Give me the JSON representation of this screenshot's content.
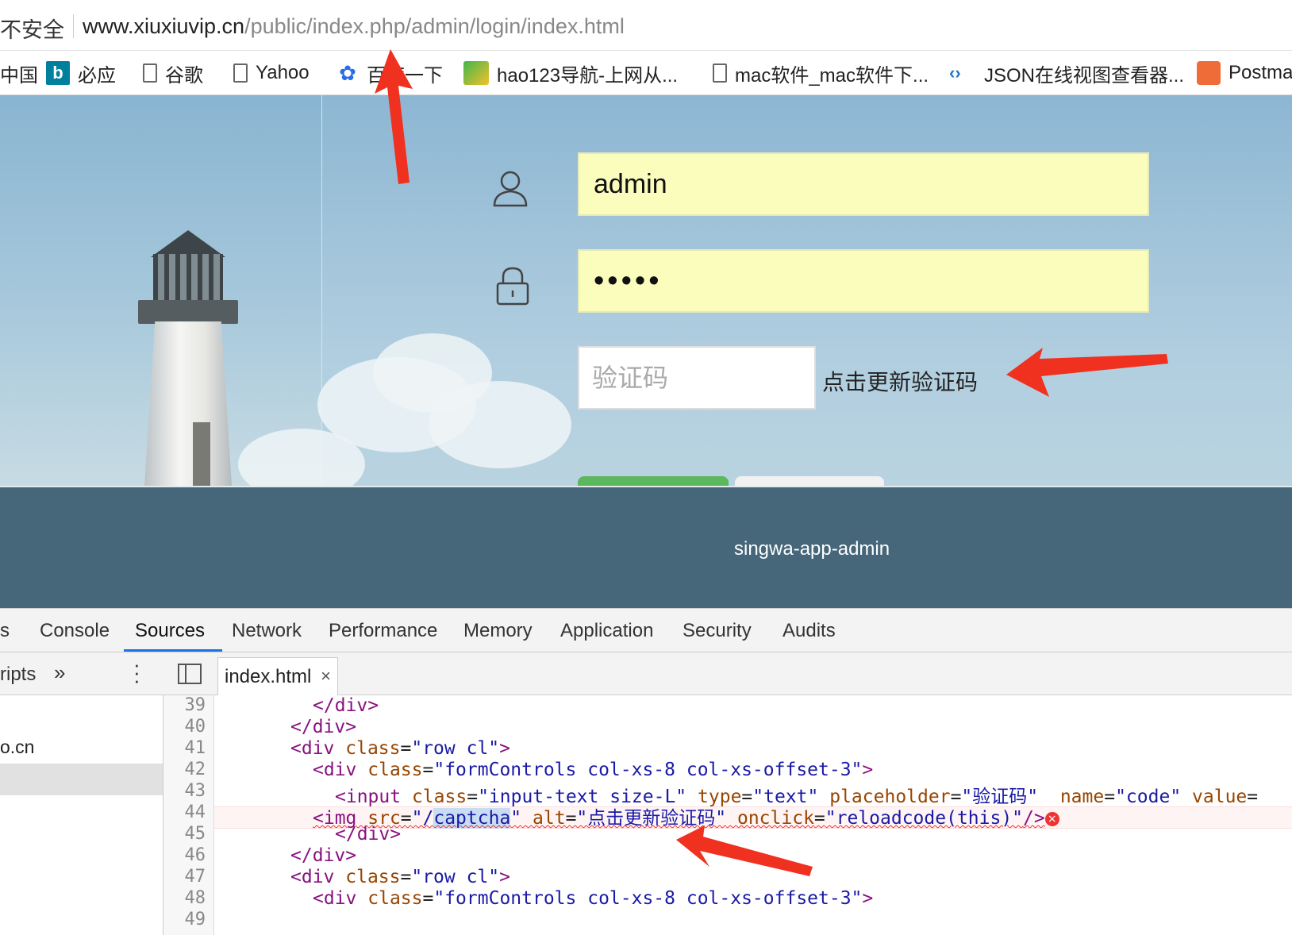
{
  "address_bar": {
    "security_label": "不安全",
    "url_host": "www.xiuxiuvip.cn",
    "url_path": "/public/index.php/admin/login/index.html"
  },
  "bookmarks": [
    {
      "label": "中国",
      "icon": "none"
    },
    {
      "label": "必应",
      "icon": "bing-icon"
    },
    {
      "label": "谷歌",
      "icon": "page-icon"
    },
    {
      "label": "Yahoo",
      "icon": "page-icon"
    },
    {
      "label": "百度一下",
      "icon": "baidu-paw-icon"
    },
    {
      "label": "hao123导航-上网从...",
      "icon": "hao123-icon"
    },
    {
      "label": "mac软件_mac软件下...",
      "icon": "page-icon"
    },
    {
      "label": "JSON在线视图查看器...",
      "icon": "json-icon"
    },
    {
      "label": "Postma",
      "icon": "postman-icon"
    }
  ],
  "login": {
    "username_value": "admin",
    "password_value": "•••••",
    "captcha_placeholder": "验证码",
    "captcha_alt_text": "点击更新验证码"
  },
  "footer": {
    "text": "singwa-app-admin"
  },
  "devtools": {
    "tabs": [
      "s",
      "Console",
      "Sources",
      "Network",
      "Performance",
      "Memory",
      "Application",
      "Security",
      "Audits"
    ],
    "active_tab": "Sources",
    "navigator_label": "ripts",
    "navigator_more": "»",
    "navigator_domain": "o.cn",
    "open_file": "index.html",
    "close_glyph": "×",
    "line_numbers": [
      "39",
      "40",
      "41",
      "42",
      "43",
      "44",
      "45",
      "46",
      "47",
      "48",
      "49"
    ],
    "code": {
      "l39": "</div>",
      "l40": "</div>",
      "l41_tag": "<div",
      "l41_attr": "class",
      "l41_val": "\"row cl\"",
      "l42_tag": "<div",
      "l42_attr": "class",
      "l42_val": "\"formControls col-xs-8 col-xs-offset-3\"",
      "l43_tag": "<input",
      "l43_a1": "class",
      "l43_v1": "\"input-text size-L\"",
      "l43_a2": "type",
      "l43_v2": "\"text\"",
      "l43_a3": "placeholder",
      "l43_v3": "\"验证码\"",
      "l43_a4": "name",
      "l43_v4": "\"code\"",
      "l43_a5": "value",
      "l44_tag": "<img",
      "l44_a1": "src",
      "l44_v1_pre": "\"/",
      "l44_v1_hl": "captcha",
      "l44_v1_post": "\"",
      "l44_a2": "alt",
      "l44_v2": "\"点击更新验证码\"",
      "l44_a3": "onclick",
      "l44_v3": "\"reloadcode(this)\"",
      "l44_end": "/>",
      "l45": "</div>",
      "l46": "</div>",
      "l47_tag": "<div",
      "l47_attr": "class",
      "l47_val": "\"row cl\"",
      "l48_tag": "<div",
      "l48_attr": "class",
      "l48_val": "\"formControls col-xs-8 col-xs-offset-3\""
    },
    "error_glyph": "×"
  },
  "colors": {
    "annotation_arrow": "#f0311f",
    "footer_bg": "#46677a",
    "input_autofill_bg": "#fbfdbd",
    "login_button_green": "#5cb85c"
  }
}
